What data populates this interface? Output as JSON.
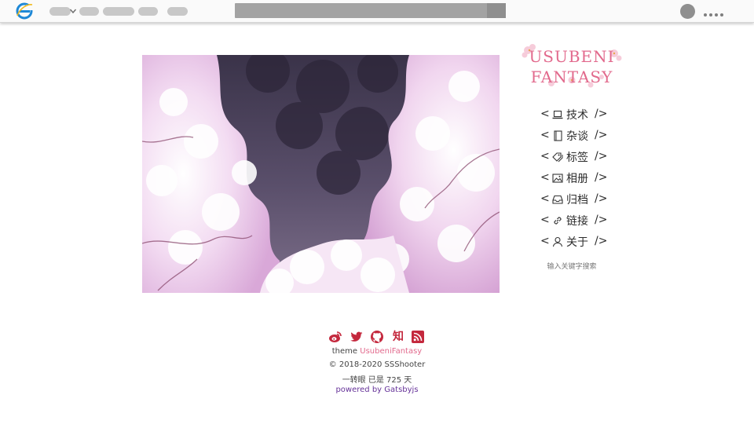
{
  "browser": {
    "icons": [
      "ie-logo-icon",
      "chevron-down-icon",
      "more-icon"
    ]
  },
  "site": {
    "logo_line_1": "USUBENI",
    "logo_line_2": "FANTASY"
  },
  "nav": {
    "open": "<",
    "close": "/>",
    "items": [
      {
        "label": "技术",
        "icon": "laptop-icon"
      },
      {
        "label": "杂谈",
        "icon": "notebook-icon"
      },
      {
        "label": "标签",
        "icon": "tags-icon"
      },
      {
        "label": "相册",
        "icon": "image-icon"
      },
      {
        "label": "归档",
        "icon": "inbox-icon"
      },
      {
        "label": "链接",
        "icon": "link-icon"
      },
      {
        "label": "关于",
        "icon": "user-icon"
      }
    ]
  },
  "search": {
    "hint": "输入关键字搜索"
  },
  "footer": {
    "social": [
      "weibo-icon",
      "twitter-icon",
      "github-icon",
      "zhihu-icon",
      "rss-icon"
    ],
    "zhihu_glyph": "知",
    "theme_prefix": "theme",
    "theme_name": "UsubeniFantasy",
    "copyright": "© 2018-2020 SSShooter",
    "uptime": "一转眼 已是 725 天",
    "powered_prefix": "powered by",
    "powered_name": "Gatsbyjs"
  },
  "colors": {
    "accent_pink": "#e26a8d",
    "social_red": "#c4283d",
    "link_purple": "#663399"
  }
}
